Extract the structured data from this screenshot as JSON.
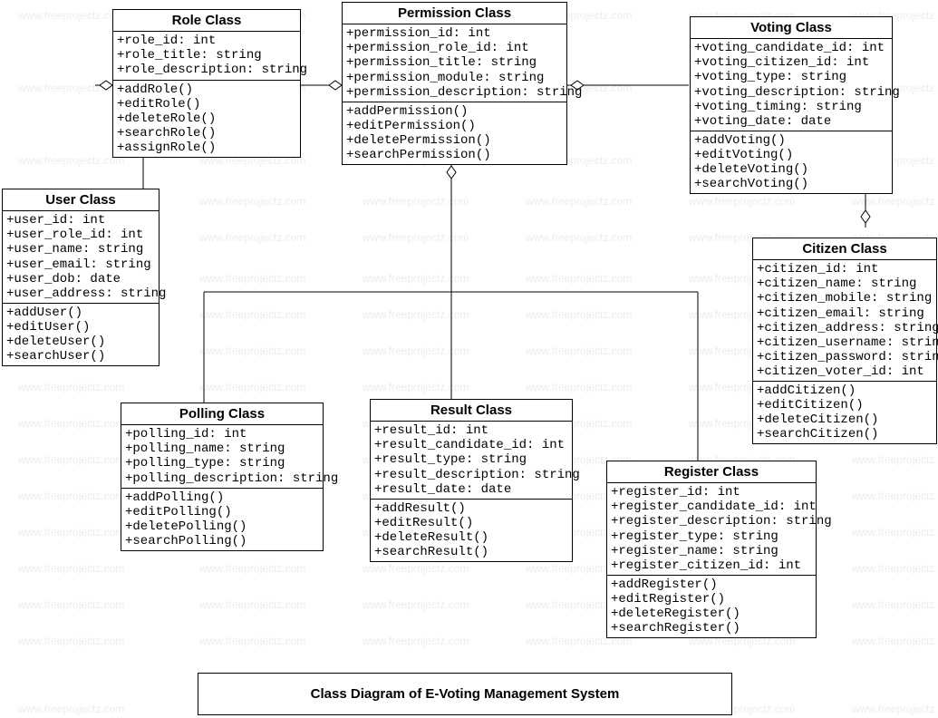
{
  "title": "Class Diagram of E-Voting Management System",
  "watermark": "www.freeprojectz.com",
  "classes": {
    "role": {
      "name": "Role Class",
      "attrs": [
        "+role_id: int",
        "+role_title: string",
        "+role_description: string"
      ],
      "methods": [
        "+addRole()",
        "+editRole()",
        "+deleteRole()",
        "+searchRole()",
        "+assignRole()"
      ]
    },
    "permission": {
      "name": "Permission Class",
      "attrs": [
        "+permission_id: int",
        "+permission_role_id: int",
        "+permission_title: string",
        "+permission_module: string",
        "+permission_description: string"
      ],
      "methods": [
        "+addPermission()",
        "+editPermission()",
        "+deletePermission()",
        "+searchPermission()"
      ]
    },
    "voting": {
      "name": "Voting Class",
      "attrs": [
        "+voting_candidate_id: int",
        "+voting_citizen_id: int",
        "+voting_type: string",
        "+voting_description: string",
        "+voting_timing: string",
        "+voting_date: date"
      ],
      "methods": [
        "+addVoting()",
        "+editVoting()",
        "+deleteVoting()",
        "+searchVoting()"
      ]
    },
    "user": {
      "name": "User Class",
      "attrs": [
        "+user_id: int",
        "+user_role_id: int",
        "+user_name: string",
        "+user_email: string",
        "+user_dob: date",
        "+user_address: string"
      ],
      "methods": [
        "+addUser()",
        "+editUser()",
        "+deleteUser()",
        "+searchUser()"
      ]
    },
    "citizen": {
      "name": "Citizen Class",
      "attrs": [
        "+citizen_id: int",
        "+citizen_name: string",
        "+citizen_mobile: string",
        "+citizen_email: string",
        "+citizen_address: string",
        "+citizen_username: string",
        "+citizen_password: string",
        "+citizen_voter_id: int"
      ],
      "methods": [
        "+addCitizen()",
        "+editCitizen()",
        "+deleteCitizen()",
        "+searchCitizen()"
      ]
    },
    "polling": {
      "name": "Polling Class",
      "attrs": [
        "+polling_id: int",
        "+polling_name: string",
        "+polling_type: string",
        "+polling_description: string"
      ],
      "methods": [
        "+addPolling()",
        "+editPolling()",
        "+deletePolling()",
        "+searchPolling()"
      ]
    },
    "result": {
      "name": "Result Class",
      "attrs": [
        "+result_id: int",
        "+result_candidate_id: int",
        "+result_type: string",
        "+result_description: string",
        "+result_date: date"
      ],
      "methods": [
        "+addResult()",
        "+editResult()",
        "+deleteResult()",
        "+searchResult()"
      ]
    },
    "register": {
      "name": "Register Class",
      "attrs": [
        "+register_id: int",
        "+register_candidate_id: int",
        "+register_description: string",
        "+register_type: string",
        "+register_name: string",
        "+register_citizen_id: int"
      ],
      "methods": [
        "+addRegister()",
        "+editRegister()",
        "+deleteRegister()",
        "+searchRegister()"
      ]
    }
  },
  "chart_data": {
    "type": "uml-class",
    "title": "Class Diagram of E-Voting Management System",
    "classes": [
      "Role Class",
      "Permission Class",
      "Voting Class",
      "User Class",
      "Citizen Class",
      "Polling Class",
      "Result Class",
      "Register Class"
    ],
    "relationships": [
      {
        "from": "User Class",
        "to": "Role Class",
        "type": "aggregation"
      },
      {
        "from": "Role Class",
        "to": "Permission Class",
        "type": "aggregation"
      },
      {
        "from": "Permission Class",
        "to": "Voting Class",
        "type": "aggregation"
      },
      {
        "from": "Permission Class",
        "to": "Polling Class",
        "type": "aggregation"
      },
      {
        "from": "Permission Class",
        "to": "Result Class",
        "type": "aggregation"
      },
      {
        "from": "Permission Class",
        "to": "Register Class",
        "type": "aggregation"
      },
      {
        "from": "Voting Class",
        "to": "Citizen Class",
        "type": "aggregation"
      }
    ]
  }
}
